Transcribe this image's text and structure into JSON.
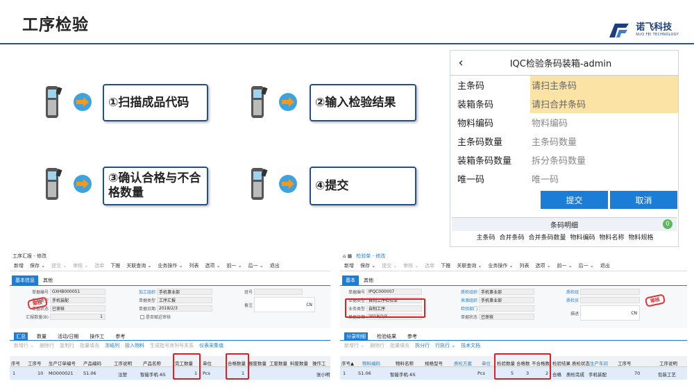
{
  "page": {
    "title": "工序检验"
  },
  "logo": {
    "brand": "诺飞科技",
    "sub": "NUO FEI TECHNOLOGY"
  },
  "steps": [
    {
      "text": "①扫描成品代码"
    },
    {
      "text": "②输入检验结果"
    },
    {
      "text": "③确认合格与不合格数量"
    },
    {
      "text": "④提交"
    }
  ],
  "mobile": {
    "title": "IQC检验条码装箱-admin",
    "rows": [
      {
        "label": "主条码",
        "placeholder": "请扫主条码"
      },
      {
        "label": "装箱条码",
        "placeholder": "请扫合并条码"
      },
      {
        "label": "物料编码",
        "placeholder": "物料编码"
      },
      {
        "label": "主条码数量",
        "placeholder": "主条码数量"
      },
      {
        "label": "装箱条码数量",
        "placeholder": "拆分条码数量"
      },
      {
        "label": "唯一码",
        "placeholder": "唯一码"
      }
    ],
    "submit": "提交",
    "cancel": "取消",
    "detail": "条码明细",
    "detail_count": "0",
    "cols": [
      "主条码",
      "合并条码",
      "合并条码数量",
      "物料编码",
      "物料名称",
      "物料规格"
    ]
  },
  "erp1": {
    "title": "工序汇报 - 修改",
    "toolbar": [
      "新增",
      "保存 ⌄",
      "提交 ⌄",
      "审核 ⌄",
      "选单",
      "下推",
      "关联查询 ⌄",
      "业务操作 ⌄",
      "列表",
      "选项 ⌄",
      "前一 ⌄",
      "后一 ⌄",
      "退出"
    ],
    "tabs": [
      "基本信息",
      "其他"
    ],
    "fields": {
      "bill_no_l": "单据编号",
      "bill_no": "GXHB000051",
      "bill_type_l": "单据类型",
      "bill_type": "手机装配",
      "status_l": "单据状态",
      "status": "已审核",
      "qty_l": "汇报数量(B)",
      "qty": "1",
      "org_l": "加工组织",
      "org": "手机事业部",
      "doctype_l": "单据类型",
      "doctype": "工序汇报",
      "date_l": "单据日期",
      "date": "2018/2/3",
      "backflush": "是否赋近审核",
      "shift_l": "班号",
      "remark_l": "备注",
      "lang": "CN"
    },
    "stamp": "审核",
    "gtabs": [
      "汇总",
      "数量",
      "活动/日期",
      "操作工",
      "参考"
    ],
    "gtb": [
      "新增行 ⌄",
      "删除行",
      "复制行",
      "批量填充",
      "冻结列",
      "投入物料",
      "生成批号序列号关系",
      "仪表采集值"
    ],
    "headers": [
      "序号",
      "工序号",
      "生产订单编号",
      "产品编码",
      "工序说明",
      "产品名称",
      "完工数量",
      "单位",
      "合格数量",
      "报废数量",
      "工废数量",
      "料废数量",
      "操作工"
    ],
    "row": [
      "1",
      "10",
      "MO000021",
      "S1.06",
      "注塑",
      "智能手机-6S",
      "1",
      "Pcs",
      "1",
      "",
      "",
      "",
      "张小明"
    ]
  },
  "erp2": {
    "title": "检验单 - 修改",
    "toolbar": [
      "新增",
      "保存 ⌄",
      "提交 ⌄",
      "审核 ⌄",
      "选单",
      "下推",
      "关联查询 ⌄",
      "业务操作 ⌄",
      "列表",
      "选项 ⌄",
      "前一 ⌄",
      "后一 ⌄",
      "退出"
    ],
    "tabs": [
      "基本",
      "其他"
    ],
    "fields": {
      "bill_no_l": "单据编号",
      "bill_no": "IPQC000007",
      "bill_type_l": "单据类型",
      "bill_type": "自制工序检验单",
      "biz_type_l": "业务类型",
      "biz_type": "自制工序",
      "date_l": "单据日期",
      "date": "2018/2/3",
      "org_l": "质检组织",
      "org": "手机事业部",
      "src_org_l": "来源组织",
      "src_org": "手机事业部",
      "dept_l": "检验部门",
      "status_l": "单据状态",
      "status": "已审核",
      "qc_l": "质检组",
      "qc2_l": "质检员",
      "desc_l": "描述",
      "lang": "CN"
    },
    "stamp": "审核",
    "gtabs": [
      "分录明细",
      "检验结果",
      "参考"
    ],
    "gtb": [
      "新增行 ⌄",
      "删除行",
      "批量填充",
      "拆分行",
      "行执行 ⌄",
      "技术文档"
    ],
    "headers": [
      "序号▲",
      "物料编码",
      "物料名称",
      "规格型号",
      "质检方案",
      "单位",
      "检验数量",
      "合格数",
      "不合格数",
      "检验结果",
      "质检状态",
      "生产车间",
      "工序号",
      "",
      "工序说明"
    ],
    "row": [
      "1",
      "S1.06",
      "智能手机-6S",
      "",
      "",
      "Pcs",
      "5",
      "3",
      "2",
      "合格",
      "质检完成",
      "手机装配",
      "70",
      "",
      "包装工艺"
    ]
  }
}
